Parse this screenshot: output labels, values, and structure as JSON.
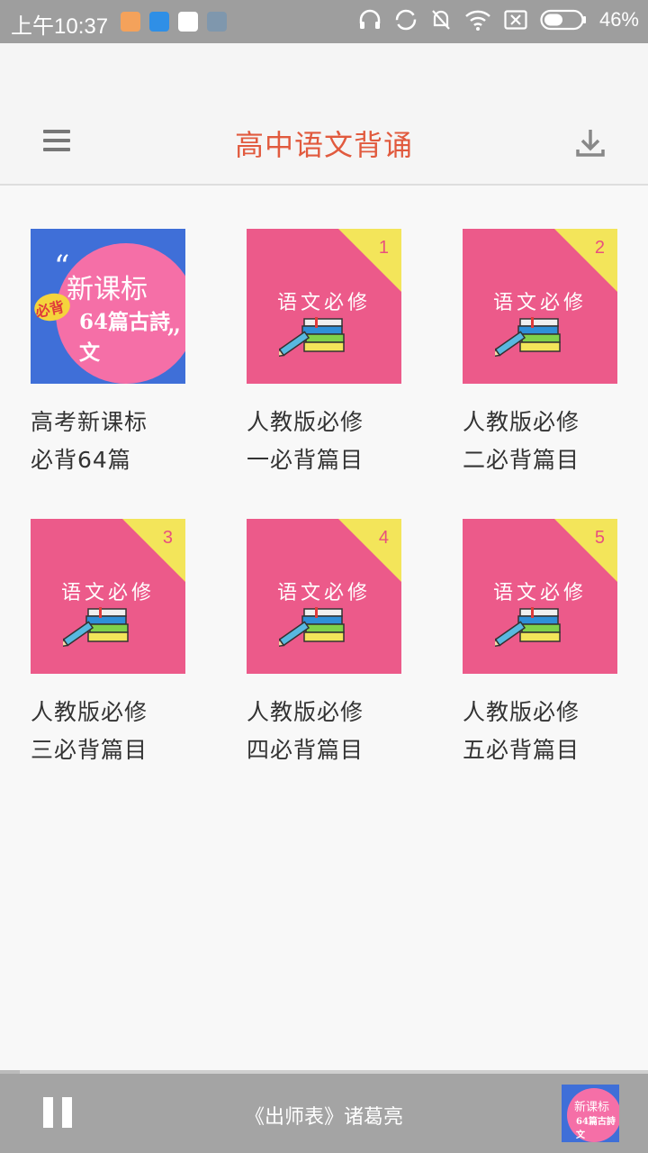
{
  "status_bar": {
    "time": "上午10:37",
    "battery": "46%"
  },
  "app_bar": {
    "title": "高中语文背诵",
    "title_color": "#e15a3e"
  },
  "cards": [
    {
      "title_line1": "高考新课标",
      "title_line2": "必背64篇",
      "special": true,
      "thumb_line1": "新课标",
      "thumb_line2": "64篇古詩文",
      "thumb_badge": "必背"
    },
    {
      "title_line1": "人教版必修",
      "title_line2": "一必背篇目",
      "thumb_label": "语文必修",
      "corner_number": "1"
    },
    {
      "title_line1": "人教版必修",
      "title_line2": "二必背篇目",
      "thumb_label": "语文必修",
      "corner_number": "2"
    },
    {
      "title_line1": "人教版必修",
      "title_line2": "三必背篇目",
      "thumb_label": "语文必修",
      "corner_number": "3"
    },
    {
      "title_line1": "人教版必修",
      "title_line2": "四必背篇目",
      "thumb_label": "语文必修",
      "corner_number": "4"
    },
    {
      "title_line1": "人教版必修",
      "title_line2": "五必背篇目",
      "thumb_label": "语文必修",
      "corner_number": "5"
    }
  ],
  "player": {
    "now_playing": "《出师表》诸葛亮",
    "thumb_line1": "新课标",
    "thumb_line2": "64篇古詩文",
    "progress": 0.03
  },
  "icons": {
    "menu": "menu-icon",
    "download": "download-icon",
    "pause": "pause-icon"
  }
}
